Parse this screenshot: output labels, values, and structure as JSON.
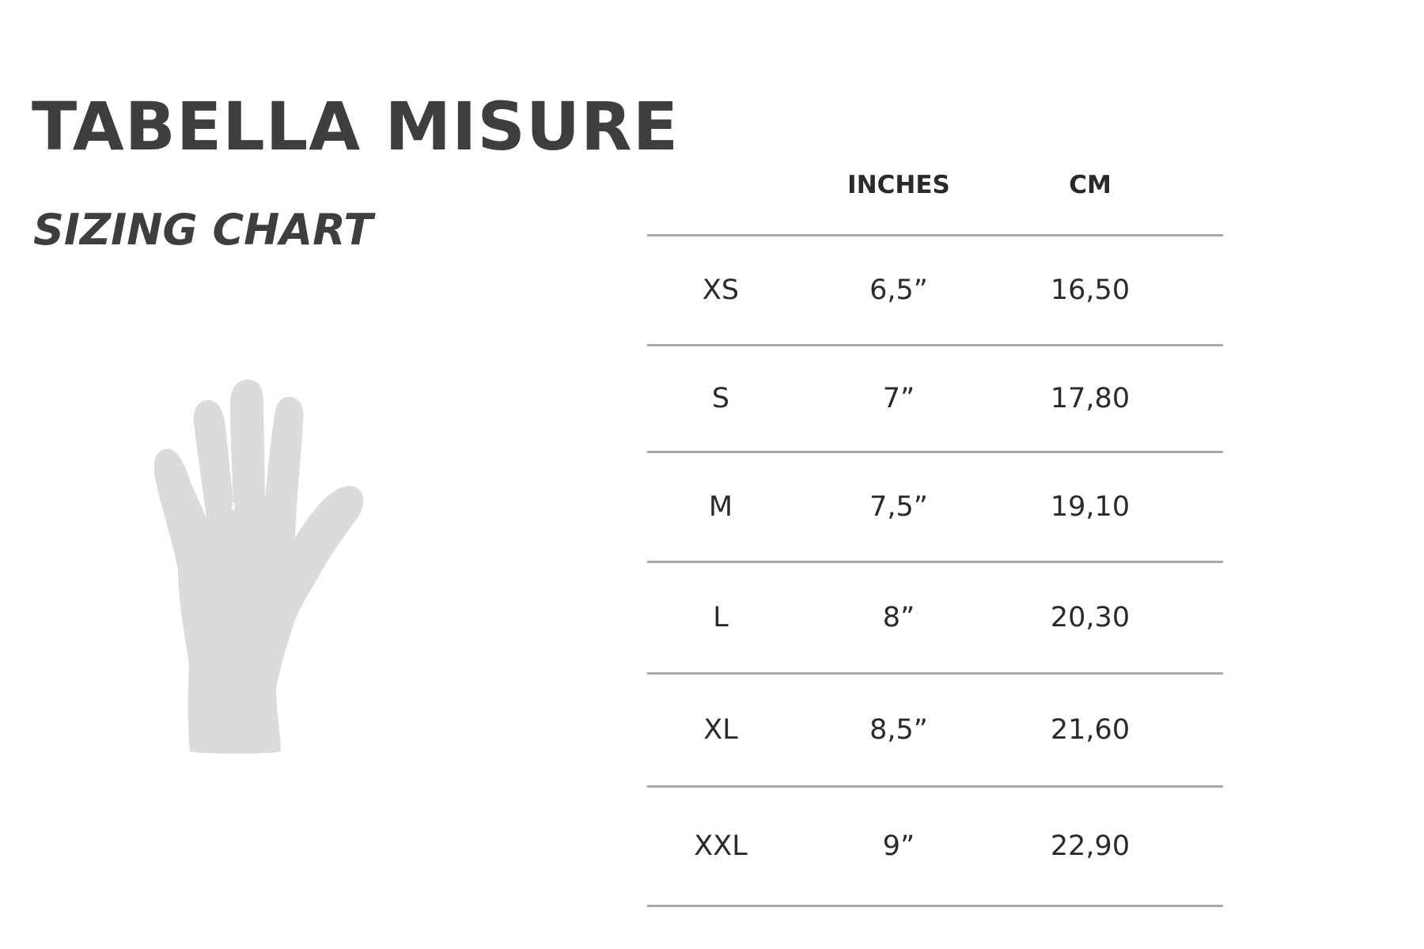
{
  "header": {
    "title": "TABELLA MISURE",
    "subtitle": "SIZING CHART"
  },
  "illustration": {
    "icon": "hand-icon",
    "color": "#dcdbdc"
  },
  "table": {
    "columns": [
      "",
      "INCHES",
      "CM"
    ],
    "rows": [
      {
        "size": "XS",
        "inches": "6,5”",
        "cm": "16,50"
      },
      {
        "size": "S",
        "inches": "7”",
        "cm": "17,80"
      },
      {
        "size": "M",
        "inches": "7,5”",
        "cm": "19,10"
      },
      {
        "size": "L",
        "inches": "8”",
        "cm": "20,30"
      },
      {
        "size": "XL",
        "inches": "8,5”",
        "cm": "21,60"
      },
      {
        "size": "XXL",
        "inches": "9”",
        "cm": "22,90"
      }
    ]
  },
  "colors": {
    "text": "#2f2f2f",
    "rule": "#a9a9a9"
  }
}
